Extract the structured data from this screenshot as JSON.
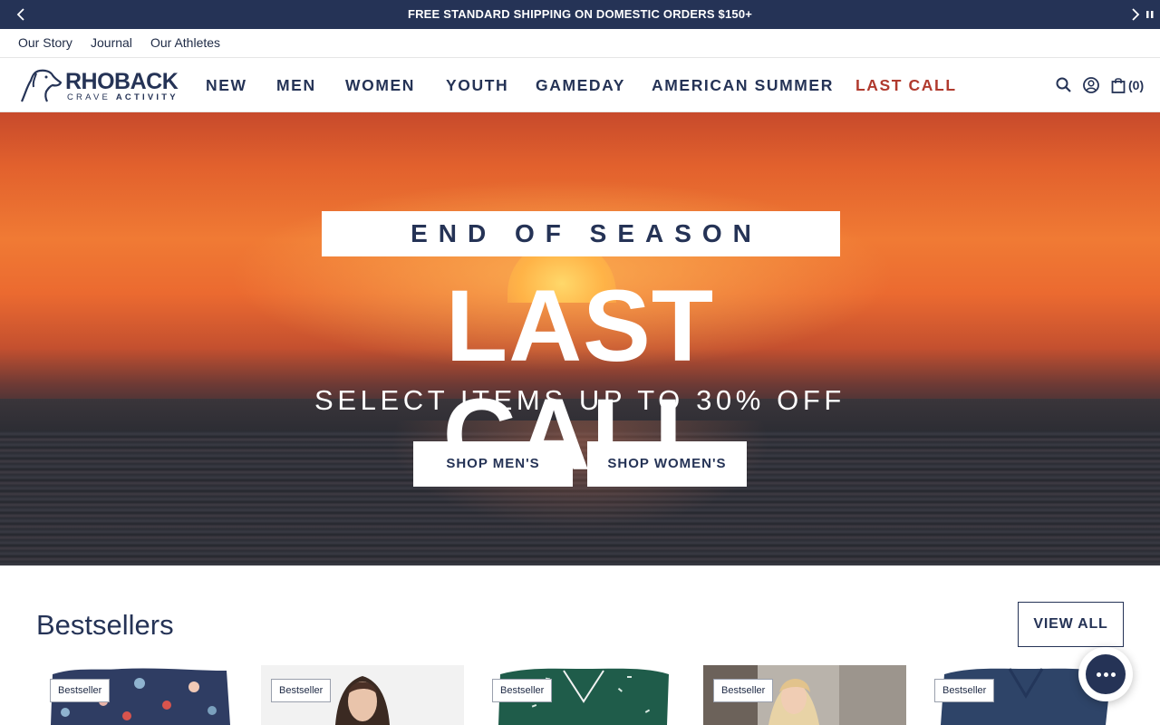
{
  "announcement": {
    "text": "FREE STANDARD SHIPPING ON DOMESTIC ORDERS $150+",
    "prev_icon": "chevron-left-icon",
    "next_icon": "chevron-right-icon",
    "pause_icon": "pause-icon"
  },
  "utility_nav": {
    "items": [
      "Our Story",
      "Journal",
      "Our Athletes"
    ]
  },
  "logo": {
    "brand": "RHOBACK",
    "tagline_a": "CRAVE ",
    "tagline_b": "ACTIVITY"
  },
  "main_nav": {
    "items": [
      "NEW",
      "MEN",
      "WOMEN",
      "YOUTH",
      "GAMEDAY",
      "AMERICAN SUMMER",
      "LAST CALL"
    ]
  },
  "header_icons": {
    "search": "search-icon",
    "account": "account-icon",
    "cart": "shopping-bag-icon",
    "cart_count": "(0)"
  },
  "hero": {
    "kicker": "END OF SEASON",
    "headline": "LAST CALL",
    "subhead": "SELECT ITEMS UP TO 30% OFF",
    "cta_men": "SHOP MEN'S",
    "cta_women": "SHOP WOMEN'S"
  },
  "bestsellers": {
    "title": "Bestsellers",
    "view_all": "VIEW ALL",
    "products": [
      {
        "badge": "Bestseller"
      },
      {
        "badge": "Bestseller"
      },
      {
        "badge": "Bestseller"
      },
      {
        "badge": "Bestseller"
      },
      {
        "badge": "Bestseller"
      }
    ]
  },
  "chat": {
    "icon": "chat-bubble-icon"
  },
  "colors": {
    "navy": "#253356",
    "sale_red": "#b03a2e",
    "white": "#ffffff"
  }
}
